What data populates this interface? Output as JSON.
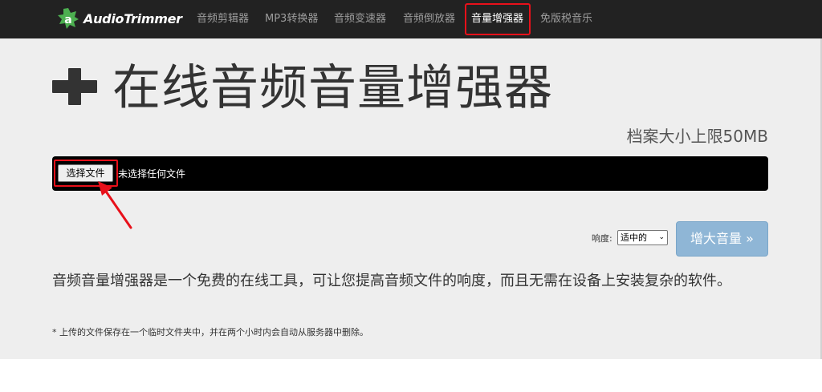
{
  "brand": {
    "name": "AudioTrimmer"
  },
  "nav": {
    "items": [
      {
        "label": "音频剪辑器"
      },
      {
        "label": "MP3转换器"
      },
      {
        "label": "音频变速器"
      },
      {
        "label": "音频倒放器"
      },
      {
        "label": "音量增强器",
        "active": true
      },
      {
        "label": "免版税音乐"
      }
    ]
  },
  "main": {
    "title": "在线音频音量增强器",
    "size_limit": "档案大小上限50MB",
    "file_input": {
      "button_label": "选择文件",
      "status": "未选择任何文件"
    },
    "loudness": {
      "label": "响度:",
      "selected": "适中的"
    },
    "submit_label": "增大音量 »",
    "description": "音频音量增强器是一个免费的在线工具，可让您提高音频文件的响度，而且无需在设备上安装复杂的软件。",
    "footnote": "* 上传的文件保存在一个临时文件夹中，并在两个小时内会自动从服务器中删除。"
  },
  "annotations": {
    "highlight_color": "#e8101a"
  },
  "colors": {
    "navbar": "#222222",
    "content_bg": "#eeeeee",
    "button_blue": "#8fb6d6"
  }
}
